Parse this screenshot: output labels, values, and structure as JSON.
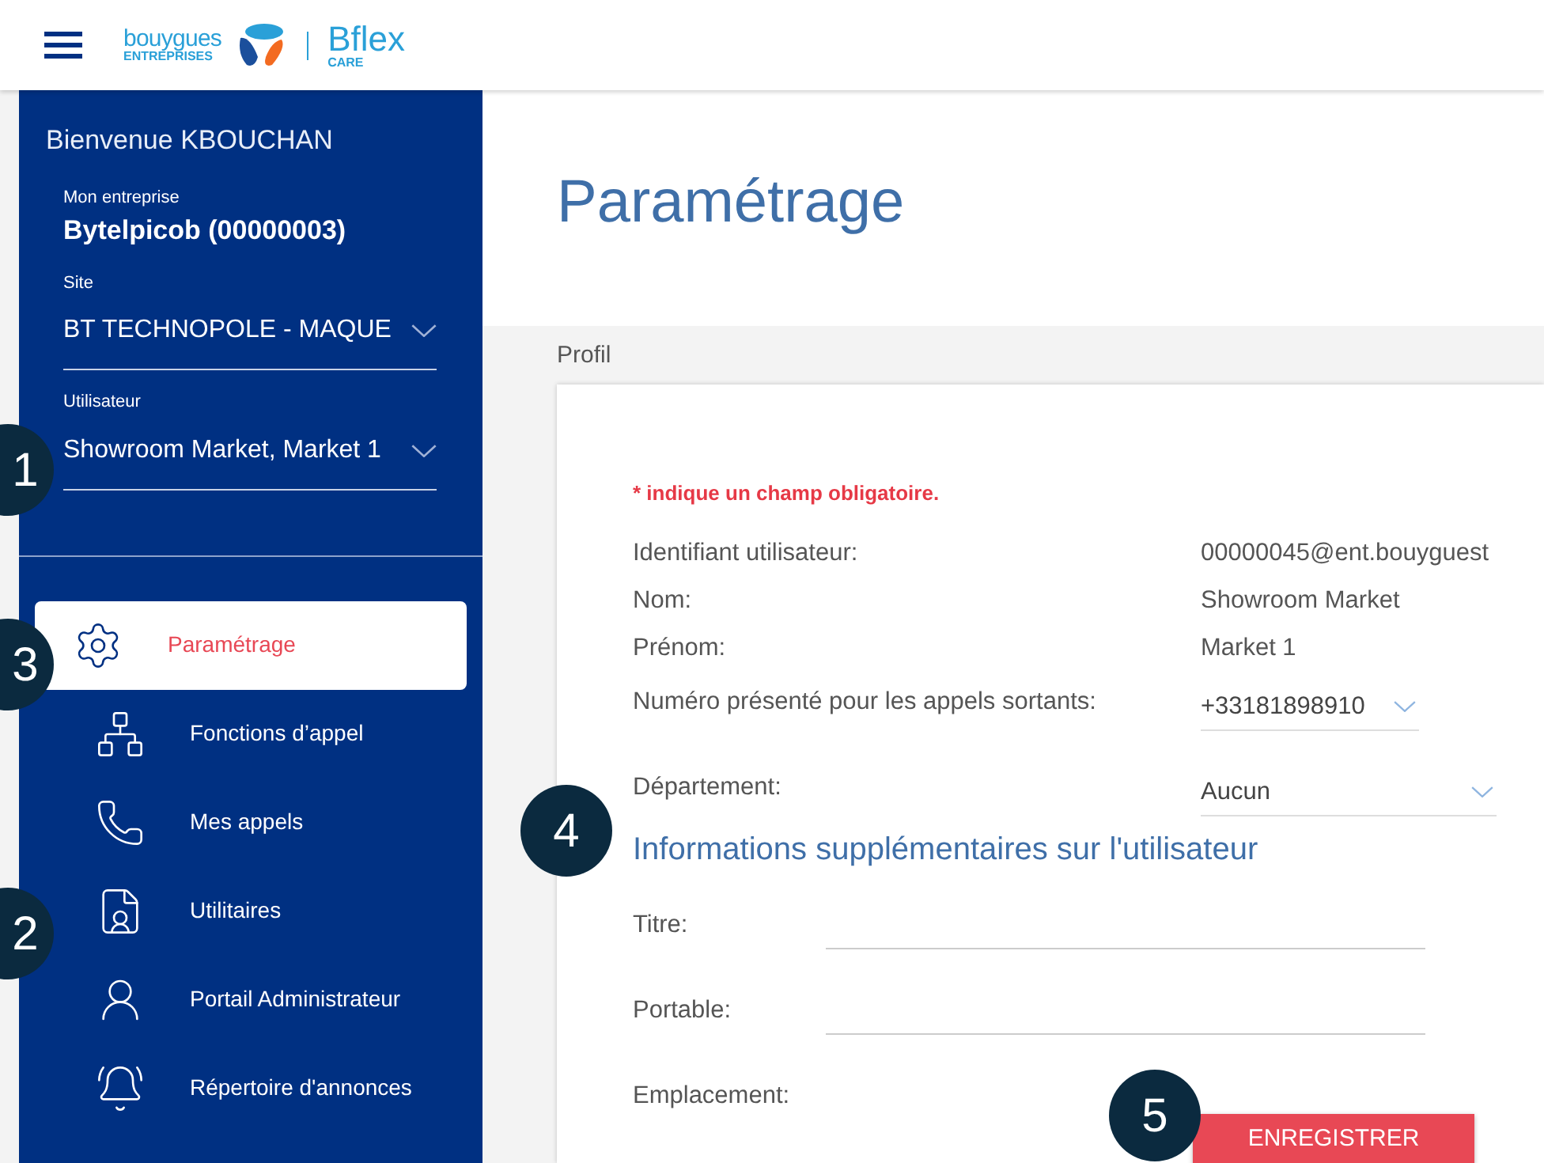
{
  "header": {
    "logo": {
      "brand": "bouygues",
      "brand_sub": "ENTREPRISES",
      "product": "Bflex",
      "product_sub": "CARE"
    }
  },
  "sidebar": {
    "welcome": "Bienvenue KBOUCHAN",
    "company": {
      "label": "Mon entreprise",
      "value": "Bytelpicob (00000003)"
    },
    "selects": [
      {
        "label": "Site",
        "value": "BT TECHNOPOLE - MAQUE"
      },
      {
        "label": "Utilisateur",
        "value": "Showroom Market, Market 1"
      }
    ],
    "items": [
      {
        "kind": "gear",
        "label": "Paramétrage",
        "selected": true
      },
      {
        "kind": "network",
        "label": "Fonctions d’appel",
        "selected": false
      },
      {
        "kind": "phone",
        "label": "Mes appels",
        "selected": false
      },
      {
        "kind": "document",
        "label": "Utilitaires",
        "selected": false
      },
      {
        "kind": "admin",
        "label": "Portail Administrateur",
        "selected": false
      },
      {
        "kind": "bell",
        "label": "Répertoire d'annonces",
        "selected": false
      }
    ]
  },
  "main": {
    "title": "Paramétrage",
    "section_label": "Profil",
    "required_note": "* indique un champ obligatoire.",
    "fields": [
      {
        "kind": "text",
        "label": "Identifiant utilisateur:",
        "value": "00000045@ent.bouyguest"
      },
      {
        "kind": "text",
        "label": "Nom:",
        "value": "Showroom Market"
      },
      {
        "kind": "text",
        "label": "Prénom:",
        "value": "Market 1"
      },
      {
        "kind": "select",
        "label": "Numéro présenté pour les appels sortants:",
        "value": "+33181898910"
      },
      {
        "kind": "select",
        "label": "Département:",
        "value": "Aucun"
      }
    ],
    "extra_heading": "Informations supplémentaires sur l'utilisateur",
    "extra_fields": [
      {
        "label": "Titre:"
      },
      {
        "label": "Portable:"
      },
      {
        "label": "Emplacement:"
      }
    ],
    "save_button": "ENREGISTRER"
  },
  "callouts": [
    "1",
    "3",
    "2",
    "4",
    "5"
  ]
}
